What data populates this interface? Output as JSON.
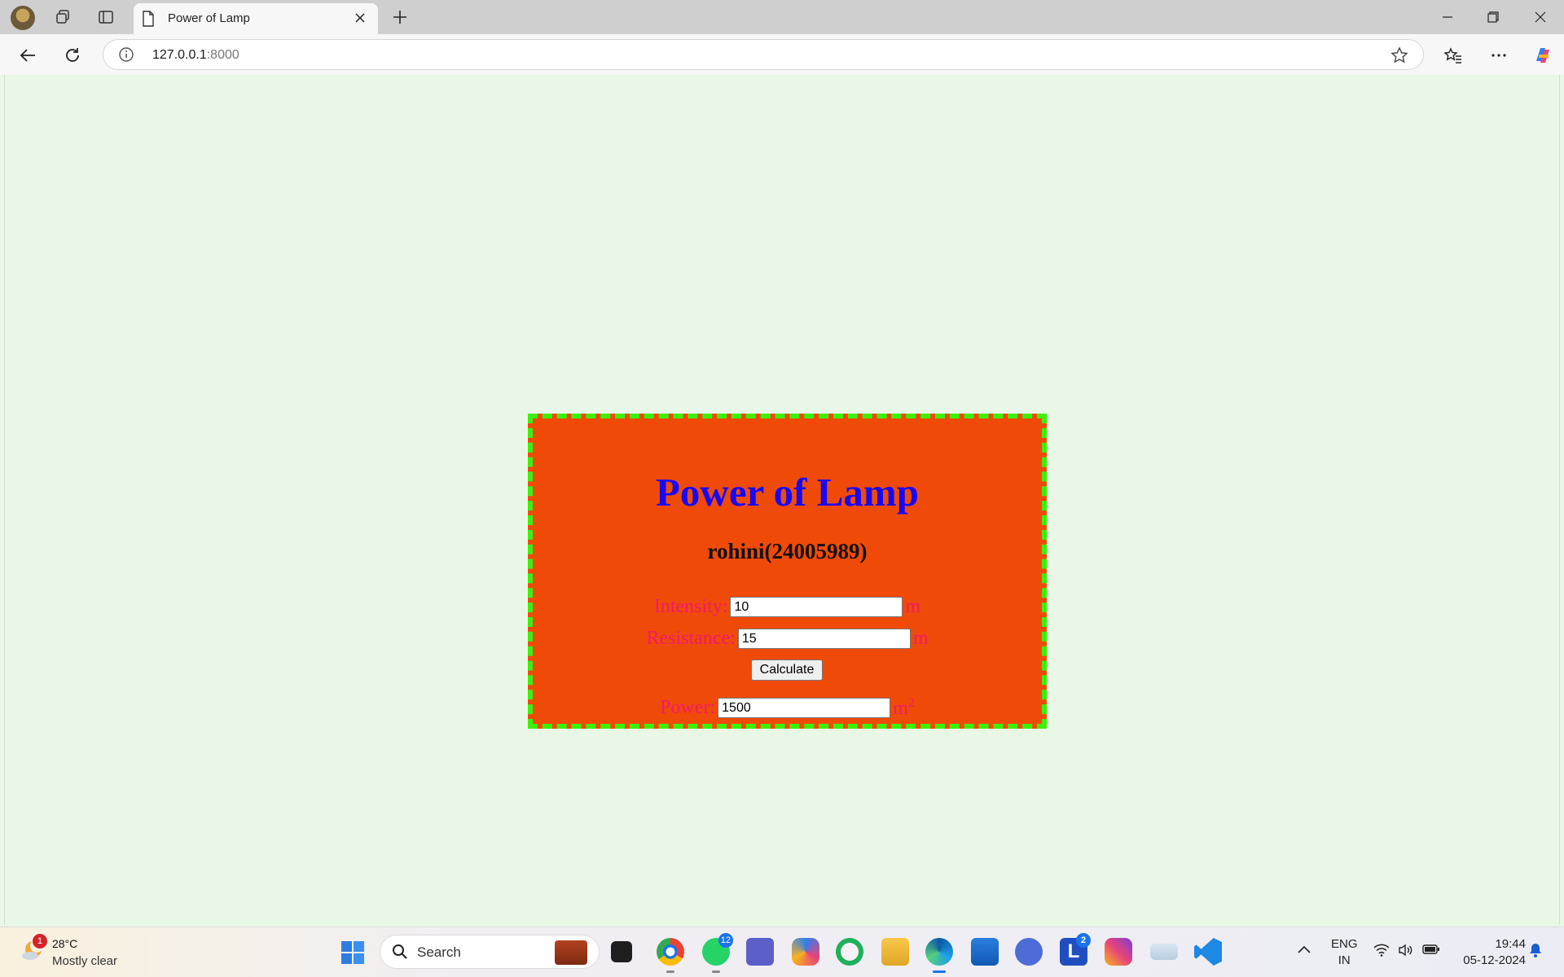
{
  "browser": {
    "tab_title": "Power of Lamp",
    "url_host": "127.0.0.1",
    "url_port": ":8000"
  },
  "page": {
    "title": "Power of Lamp",
    "subtitle": "rohini(24005989)",
    "intensity_label": "Intensity:",
    "intensity_value": "10",
    "intensity_unit": "m",
    "resistance_label": "Resistance:",
    "resistance_value": "15",
    "resistance_unit": "m",
    "calculate_label": "Calculate",
    "power_label": "Power:",
    "power_value": "1500",
    "power_unit": "m",
    "power_unit_exp": "2"
  },
  "colors": {
    "page_bg": "#e9f7e6",
    "card_bg": "#f04a09",
    "card_border": "#3cf00b",
    "title": "#1808f4",
    "label": "#f01c6a"
  },
  "taskbar": {
    "weather_badge": "1",
    "weather_temp": "28°C",
    "weather_desc": "Mostly clear",
    "search_text": "Search",
    "whatsapp_badge": "12",
    "l_app_badge": "2",
    "l_app_letter": "L",
    "lang_line1": "ENG",
    "lang_line2": "IN",
    "time": "19:44",
    "date": "05-12-2024"
  }
}
